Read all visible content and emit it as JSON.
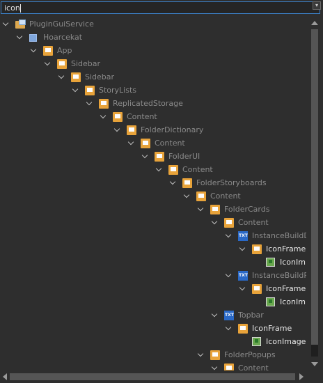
{
  "search": {
    "value": "icon"
  },
  "tree": [
    {
      "label": "PluginGuiService",
      "icon": "service",
      "depth": 0,
      "expanded": true,
      "match": false
    },
    {
      "label": "Hoarcekat",
      "icon": "screengui",
      "depth": 1,
      "expanded": true,
      "match": false
    },
    {
      "label": "App",
      "icon": "frame",
      "depth": 2,
      "expanded": true,
      "match": false
    },
    {
      "label": "Sidebar",
      "icon": "frame",
      "depth": 3,
      "expanded": true,
      "match": false
    },
    {
      "label": "Sidebar",
      "icon": "frame",
      "depth": 4,
      "expanded": true,
      "match": false
    },
    {
      "label": "StoryLists",
      "icon": "frame",
      "depth": 5,
      "expanded": true,
      "match": false
    },
    {
      "label": "ReplicatedStorage",
      "icon": "frame",
      "depth": 6,
      "expanded": true,
      "match": false
    },
    {
      "label": "Content",
      "icon": "frame",
      "depth": 7,
      "expanded": true,
      "match": false
    },
    {
      "label": "FolderDictionary",
      "icon": "frame",
      "depth": 8,
      "expanded": true,
      "match": false
    },
    {
      "label": "Content",
      "icon": "frame",
      "depth": 9,
      "expanded": true,
      "match": false
    },
    {
      "label": "FolderUI",
      "icon": "frame",
      "depth": 10,
      "expanded": true,
      "match": false
    },
    {
      "label": "Content",
      "icon": "frame",
      "depth": 11,
      "expanded": true,
      "match": false
    },
    {
      "label": "FolderStoryboards",
      "icon": "frame",
      "depth": 12,
      "expanded": true,
      "match": false
    },
    {
      "label": "Content",
      "icon": "frame",
      "depth": 13,
      "expanded": true,
      "match": false
    },
    {
      "label": "FolderCards",
      "icon": "frame",
      "depth": 14,
      "expanded": true,
      "match": false
    },
    {
      "label": "Content",
      "icon": "frame",
      "depth": 15,
      "expanded": true,
      "match": false
    },
    {
      "label": "InstanceBuildD",
      "icon": "textlabel",
      "depth": 16,
      "expanded": true,
      "match": false
    },
    {
      "label": "IconFrame",
      "icon": "frame",
      "depth": 17,
      "expanded": true,
      "match": true
    },
    {
      "label": "IconIm",
      "icon": "image",
      "depth": 18,
      "expanded": false,
      "match": true
    },
    {
      "label": "InstanceBuildP",
      "icon": "textlabel",
      "depth": 16,
      "expanded": true,
      "match": false
    },
    {
      "label": "IconFrame",
      "icon": "frame",
      "depth": 17,
      "expanded": true,
      "match": true
    },
    {
      "label": "IconIm",
      "icon": "image",
      "depth": 18,
      "expanded": false,
      "match": true
    },
    {
      "label": "Topbar",
      "icon": "textlabel",
      "depth": 15,
      "expanded": true,
      "match": false
    },
    {
      "label": "IconFrame",
      "icon": "frame",
      "depth": 16,
      "expanded": true,
      "match": true
    },
    {
      "label": "IconImage",
      "icon": "image",
      "depth": 17,
      "expanded": false,
      "match": true
    },
    {
      "label": "FolderPopups",
      "icon": "frame",
      "depth": 14,
      "expanded": true,
      "match": false
    },
    {
      "label": "Content",
      "icon": "frame",
      "depth": 15,
      "expanded": true,
      "match": false
    }
  ]
}
